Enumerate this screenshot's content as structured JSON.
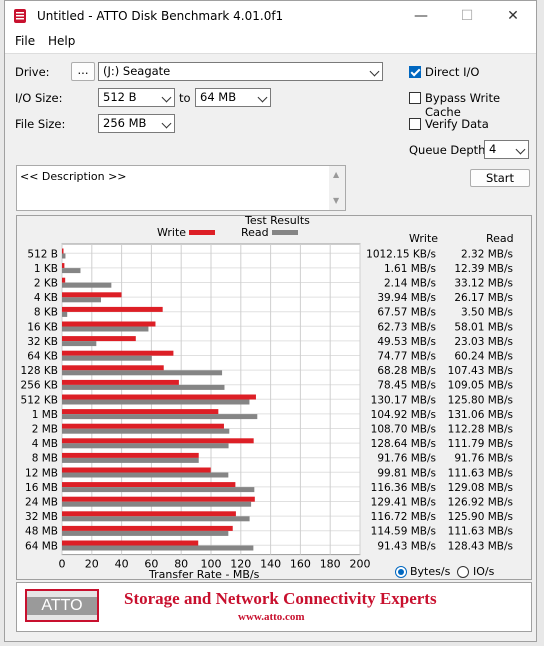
{
  "window": {
    "title": "Untitled - ATTO Disk Benchmark 4.01.0f1",
    "minimize": "—",
    "maximize": "☐",
    "close": "✕"
  },
  "menu": {
    "file": "File",
    "help": "Help"
  },
  "settings": {
    "drive_label": "Drive:",
    "browse_label": "...",
    "drive_value": "(J:) Seagate",
    "io_size_label": "I/O Size:",
    "io_from": "512 B",
    "io_to_label": "to",
    "io_to": "64 MB",
    "file_size_label": "File Size:",
    "file_size": "256 MB",
    "direct_io_label": "Direct I/O",
    "direct_io_checked": true,
    "bypass_label": "Bypass Write Cache",
    "bypass_checked": false,
    "verify_label": "Verify Data",
    "verify_checked": false,
    "queue_label": "Queue Depth:",
    "queue_value": "4",
    "start_label": "Start",
    "description_text": "<< Description >>"
  },
  "results": {
    "title": "Test Results",
    "legend_write": "Write",
    "legend_read": "Read",
    "col_write": "Write",
    "col_read": "Read",
    "xlabel": "Transfer Rate - MB/s",
    "units_bytes": "Bytes/s",
    "units_io": "IO/s",
    "units_selected": "bytes"
  },
  "colors": {
    "write": "#dd1f26",
    "read": "#858585",
    "accent": "#0067c0"
  },
  "chart_data": {
    "type": "bar",
    "orientation": "horizontal",
    "title": "Test Results",
    "xlabel": "Transfer Rate - MB/s",
    "xlim": [
      0,
      200
    ],
    "xticks": [
      0,
      20,
      40,
      60,
      80,
      100,
      120,
      140,
      160,
      180,
      200
    ],
    "grid": true,
    "legend": "top",
    "categories": [
      "512 B",
      "1 KB",
      "2 KB",
      "4 KB",
      "8 KB",
      "16 KB",
      "32 KB",
      "64 KB",
      "128 KB",
      "256 KB",
      "512 KB",
      "1 MB",
      "2 MB",
      "4 MB",
      "8 MB",
      "12 MB",
      "16 MB",
      "24 MB",
      "32 MB",
      "48 MB",
      "64 MB"
    ],
    "series": [
      {
        "name": "Write",
        "values": [
          0.99,
          1.61,
          2.14,
          39.94,
          67.57,
          62.73,
          49.53,
          74.77,
          68.28,
          78.45,
          130.17,
          104.92,
          108.7,
          128.64,
          91.76,
          99.81,
          116.36,
          129.41,
          116.72,
          114.59,
          91.43
        ]
      },
      {
        "name": "Read",
        "values": [
          2.32,
          12.39,
          33.12,
          26.17,
          3.5,
          58.01,
          23.03,
          60.24,
          107.43,
          109.05,
          125.8,
          131.06,
          112.28,
          111.79,
          91.76,
          111.63,
          129.08,
          126.92,
          125.9,
          111.63,
          128.43
        ]
      }
    ],
    "write_labels": [
      "1012.15 KB/s",
      "1.61 MB/s",
      "2.14 MB/s",
      "39.94 MB/s",
      "67.57 MB/s",
      "62.73 MB/s",
      "49.53 MB/s",
      "74.77 MB/s",
      "68.28 MB/s",
      "78.45 MB/s",
      "130.17 MB/s",
      "104.92 MB/s",
      "108.70 MB/s",
      "128.64 MB/s",
      "91.76 MB/s",
      "99.81 MB/s",
      "116.36 MB/s",
      "129.41 MB/s",
      "116.72 MB/s",
      "114.59 MB/s",
      "91.43 MB/s"
    ],
    "read_labels": [
      "2.32 MB/s",
      "12.39 MB/s",
      "33.12 MB/s",
      "26.17 MB/s",
      "3.50 MB/s",
      "58.01 MB/s",
      "23.03 MB/s",
      "60.24 MB/s",
      "107.43 MB/s",
      "109.05 MB/s",
      "125.80 MB/s",
      "131.06 MB/s",
      "112.28 MB/s",
      "111.79 MB/s",
      "91.76 MB/s",
      "111.63 MB/s",
      "129.08 MB/s",
      "126.92 MB/s",
      "125.90 MB/s",
      "111.63 MB/s",
      "128.43 MB/s"
    ]
  },
  "banner": {
    "logo": "ATTO",
    "tagline": "Storage and Network Connectivity Experts",
    "url": "www.atto.com"
  }
}
